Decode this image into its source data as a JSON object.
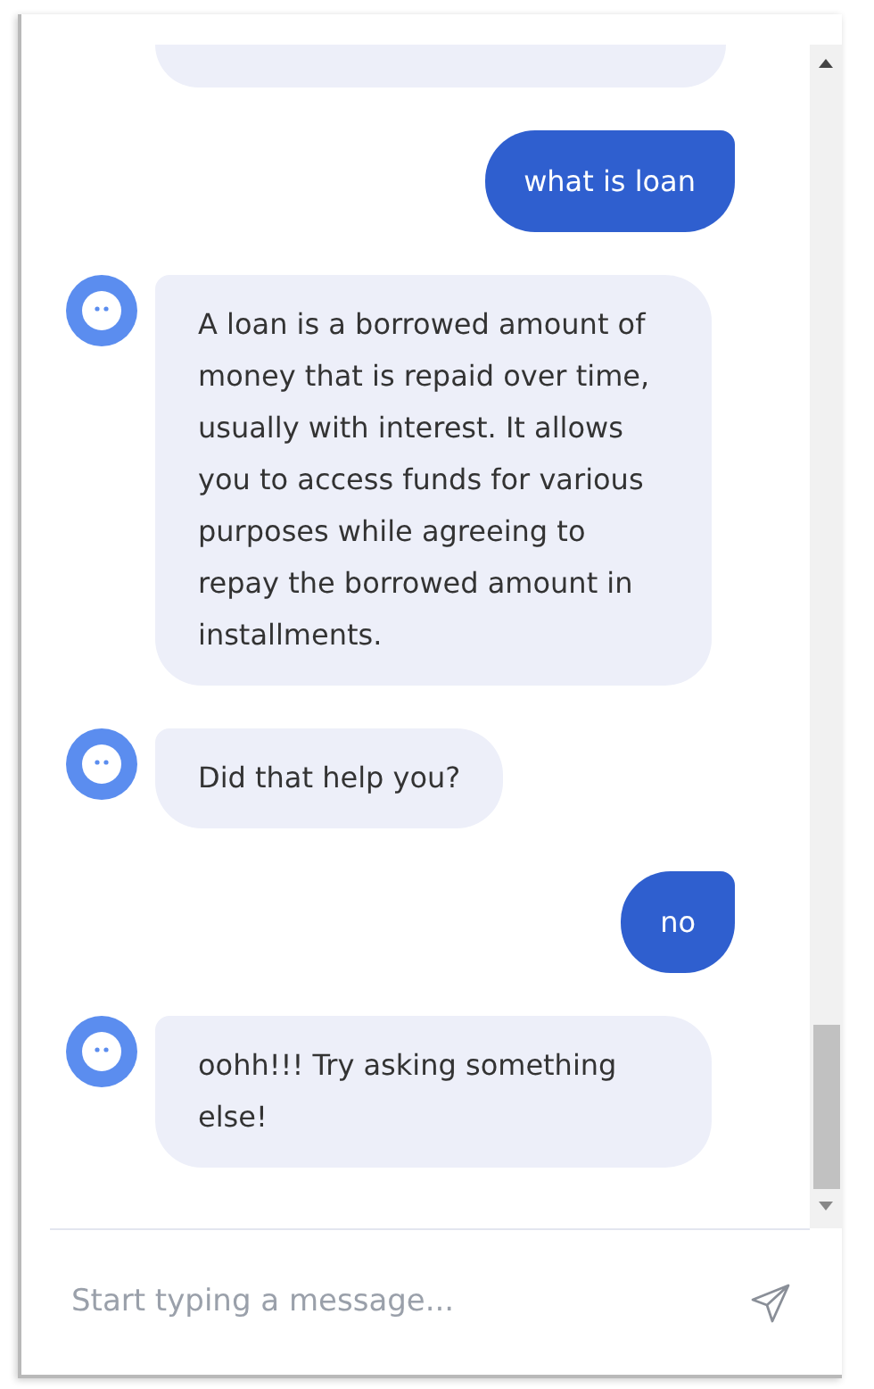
{
  "messages": [
    {
      "kind": "bot",
      "clipped": true
    },
    {
      "kind": "user",
      "clipped": false,
      "text": "what is loan"
    },
    {
      "kind": "bot",
      "clipped": false,
      "text": "A loan is a borrowed amount of money that is repaid over time, usually with interest. It allows you to access funds for various purposes while agreeing to repay the borrowed amount in installments."
    },
    {
      "kind": "bot",
      "clipped": false,
      "text": "Did that help you?"
    },
    {
      "kind": "user",
      "clipped": false,
      "text": "no"
    },
    {
      "kind": "bot",
      "clipped": false,
      "text": "oohh!!! Try asking something else!"
    }
  ],
  "composer": {
    "placeholder": "Start typing a message..."
  }
}
